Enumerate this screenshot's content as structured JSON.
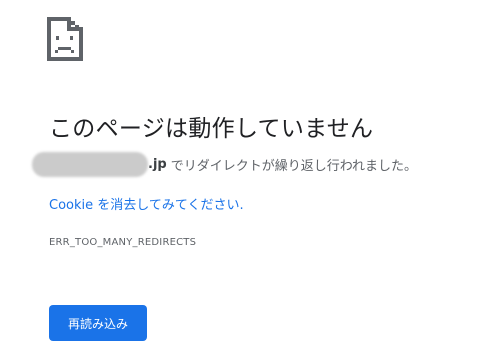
{
  "error_page": {
    "icon": "sad-page-icon",
    "title": "このページは動作していません",
    "domain_suffix": ".jp",
    "description": "でリダイレクトが繰り返し行われました。",
    "cookie_link": "Cookie を消去してみてください.",
    "error_code": "ERR_TOO_MANY_REDIRECTS",
    "reload_button": "再読み込み"
  },
  "colors": {
    "link": "#1a73e8",
    "button_bg": "#1a73e8",
    "title_text": "#202124",
    "secondary_text": "#5f6368"
  }
}
